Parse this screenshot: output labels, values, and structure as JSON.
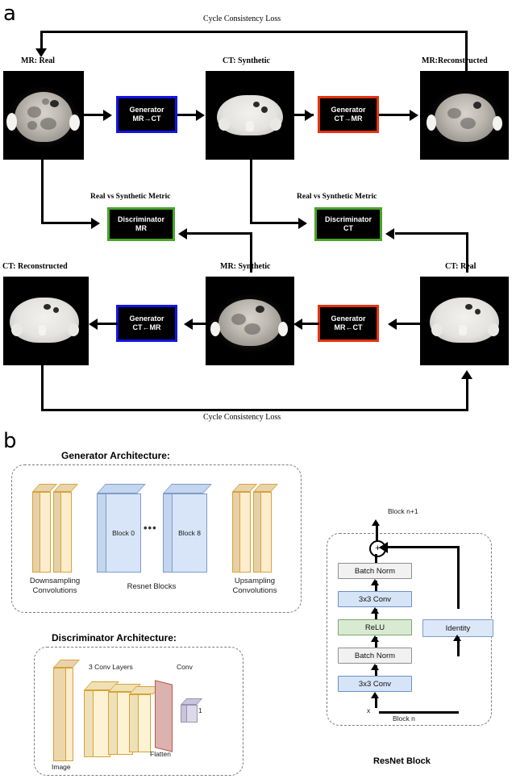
{
  "panels": {
    "a_letter": "a",
    "b_letter": "b"
  },
  "panel_a": {
    "cycle_loss_top": "Cycle Consistency Loss",
    "cycle_loss_bottom": "Cycle Consistency Loss",
    "metric_left": "Real vs Synthetic Metric",
    "metric_right": "Real vs Synthetic Metric",
    "images": {
      "mr_real": "MR: Real",
      "ct_synthetic": "CT: Synthetic",
      "mr_reconstructed": "MR:Reconstructed",
      "ct_reconstructed": "CT: Reconstructed",
      "mr_synthetic": "MR: Synthetic",
      "ct_real": "CT: Real"
    },
    "modules": {
      "gen_mr_to_ct_line1": "Generator",
      "gen_mr_to_ct_line2": "MR→CT",
      "gen_ct_to_mr_line1": "Generator",
      "gen_ct_to_mr_line2": "CT→MR",
      "gen_ct_from_mr_line1": "Generator",
      "gen_ct_from_mr_line2": "CT←MR",
      "gen_mr_from_ct_line1": "Generator",
      "gen_mr_from_ct_line2": "MR←CT",
      "disc_mr_line1": "Discriminator",
      "disc_mr_line2": "MR",
      "disc_ct_line1": "Discriminator",
      "disc_ct_line2": "CT"
    },
    "colors": {
      "generator_forward_border": "#1414e6",
      "generator_backward_border": "#e5320f",
      "discriminator_border": "#4aa32b",
      "module_fill": "#000000",
      "module_text": "#ffffff"
    }
  },
  "panel_b": {
    "generator": {
      "title": "Generator Architecture:",
      "downsampling_label_line1": "Downsampling",
      "downsampling_label_line2": "Convolutions",
      "resnet_label": "Resnet Blocks",
      "upsampling_label_line1": "Upsampling",
      "upsampling_label_line2": "Convolutions",
      "block_first": "Block 0",
      "block_last": "Block 8",
      "ellipsis": "•••",
      "colors": {
        "conv_fill": "#fdeccd",
        "conv_border": "#d6a336",
        "resnet_fill": "#d8e5f8",
        "resnet_border": "#7d9cc8"
      }
    },
    "discriminator": {
      "title": "Discriminator Architecture:",
      "image_label": "Image",
      "conv_layers_label": "3 Conv Layers",
      "conv_label": "Conv",
      "flatten_label": "Flatten",
      "output_label": "1",
      "colors": {
        "image_fill": "#fdeccd",
        "image_border": "#d6a336",
        "flatten_fill": "#dbb2ae",
        "flatten_border": "#b9564d",
        "output_fill": "#ded9ea",
        "output_border": "#9a93b0"
      }
    },
    "resnet_block": {
      "title": "ResNet Block",
      "input_label": "x",
      "block_n_label": "Block n",
      "block_next_label": "Block n+1",
      "add_symbol": "+",
      "stack": [
        "Batch Norm",
        "3x3 Conv",
        "ReLU",
        "Batch Norm",
        "3x3 Conv"
      ],
      "identity_label": "Identity",
      "colors": {
        "batchnorm_fill": "#f1f1f1",
        "conv_fill": "#d6e4f7",
        "relu_fill": "#d9ead3",
        "identity_fill": "#dce8f8"
      }
    }
  }
}
